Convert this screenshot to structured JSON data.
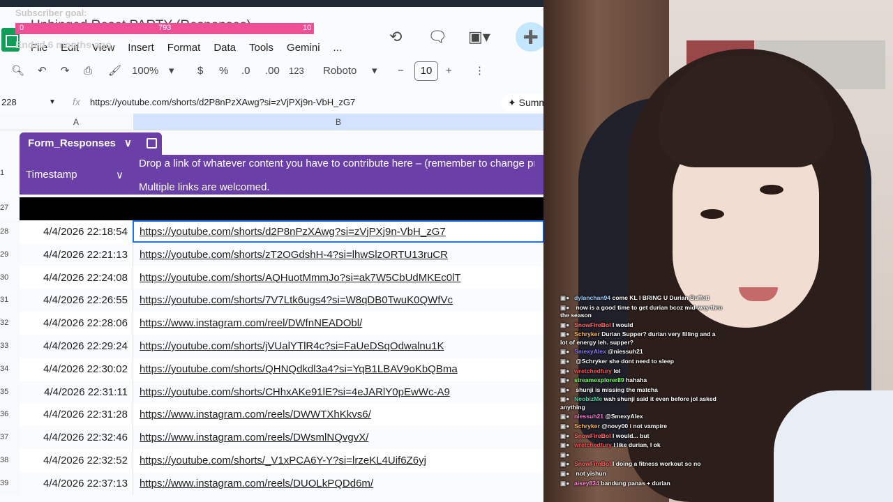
{
  "app": {
    "title": "Unhinged Reset PARTY (Responses)"
  },
  "overlay": {
    "goal_label": "Subscriber goal:",
    "goal_min": "0",
    "goal_current": "793",
    "goal_max": "10",
    "goal_status": "Ended 6 months ago"
  },
  "menu": [
    "File",
    "Edit",
    "View",
    "Insert",
    "Format",
    "Data",
    "Tools",
    "Gemini",
    "..."
  ],
  "toolbar": {
    "zoom": "100%",
    "currency": "$",
    "percent": "%",
    "dec_decrease": ".0",
    "dec_increase": ".00",
    "number_format": "123",
    "font": "Roboto",
    "font_size": "10",
    "minus": "−",
    "plus": "+"
  },
  "formula_bar": {
    "name_box": "228",
    "fx": "fx",
    "content": "https://youtube.com/shorts/d2P8nPzXAwg?si=zVjPXj9n-VbH_zG7",
    "summarize_label": "Summ"
  },
  "columns": [
    "A",
    "B"
  ],
  "table": {
    "name": "Form_Responses",
    "header_timestamp": "Timestamp",
    "header_b_line1": "Drop a link of whatever content you have to contribute here – (remember to change privac",
    "header_b_line2": "Multiple links are welcomed.",
    "header_row_num": "1",
    "black_row_num": "27"
  },
  "rows": [
    {
      "num": "28",
      "timestamp": "4/4/2026 22:18:54",
      "link": "https://youtube.com/shorts/d2P8nPzXAwg?si=zVjPXj9n-VbH_zG7"
    },
    {
      "num": "29",
      "timestamp": "4/4/2026 22:21:13",
      "link": "https://youtube.com/shorts/zT2OGdshH-4?si=lhwSlzORTU13ruCR"
    },
    {
      "num": "30",
      "timestamp": "4/4/2026 22:24:08",
      "link": "https://youtube.com/shorts/AQHuotMmmJo?si=ak7W5CbUdMKEc0lT"
    },
    {
      "num": "31",
      "timestamp": "4/4/2026 22:26:55",
      "link": "https://youtube.com/shorts/7V7Ltk6ugs4?si=W8qDB0TwuK0QWfVc"
    },
    {
      "num": "32",
      "timestamp": "4/4/2026 22:28:06",
      "link": "https://www.instagram.com/reel/DWfnNEADObl/"
    },
    {
      "num": "33",
      "timestamp": "4/4/2026 22:29:24",
      "link": "https://youtube.com/shorts/jVUalYTlR4c?si=FaUeDSqOdwalnu1K"
    },
    {
      "num": "34",
      "timestamp": "4/4/2026 22:30:02",
      "link": "https://youtube.com/shorts/QHNQdkdl3a4?si=YqB1LBAV9oKbQBma"
    },
    {
      "num": "35",
      "timestamp": "4/4/2026 22:31:11",
      "link": "https://youtube.com/shorts/CHhxAKe91lE?si=4eJARlY0pEwWc-A9"
    },
    {
      "num": "36",
      "timestamp": "4/4/2026 22:31:28",
      "link": "https://www.instagram.com/reels/DWWTXhKkvs6/"
    },
    {
      "num": "37",
      "timestamp": "4/4/2026 22:32:46",
      "link": "https://www.instagram.com/reels/DWsmlNQvgvX/"
    },
    {
      "num": "38",
      "timestamp": "4/4/2026 22:32:52",
      "link": "https://youtube.com/shorts/_V1xPCA6Y-Y?si=lrzeKL4Uif6Z6yj"
    },
    {
      "num": "39",
      "timestamp": "4/4/2026 22:37:13",
      "link": "https://www.instagram.com/reels/DUOLkPQDd6m/"
    }
  ],
  "chat": [
    {
      "user": "dylanchan94",
      "color": "#9fd2ff",
      "text": "come KL I BRING U Durian Buffett"
    },
    {
      "user": "",
      "color": "#7d7dff",
      "text": "now is a good time to get durian bcoz mid-way thru the season"
    },
    {
      "user": "SnowFireBol",
      "color": "#ff6a6a",
      "text": "I would"
    },
    {
      "user": "Schryker",
      "color": "#ffb84d",
      "text": "Durian Supper? durian very filling and a lot of energy leh. supper?"
    },
    {
      "user": "SmexyAlex",
      "color": "#8a7dff",
      "text": "@niessuh21"
    },
    {
      "user": "",
      "color": "#ff5da2",
      "text": "@Schryker she dont need to sleep"
    },
    {
      "user": "wretchedfury",
      "color": "#ff4f4f",
      "text": "lol"
    },
    {
      "user": "streamexplorer89",
      "color": "#7dff6a",
      "text": "hahaha"
    },
    {
      "user": "",
      "color": "#7d7dff",
      "text": "shunji is missing the matcha"
    },
    {
      "user": "NeobizMe",
      "color": "#4dd2a0",
      "text": "wah shunji said it even before jol asked anything"
    },
    {
      "user": "niessuh21",
      "color": "#ff7dd2",
      "text": "@SmexyAlex"
    },
    {
      "user": "Schryker",
      "color": "#ffb84d",
      "text": "@novy00 i not vampire"
    },
    {
      "user": "SnowFireBol",
      "color": "#ff6a6a",
      "text": "I would... but"
    },
    {
      "user": "wretchedfury",
      "color": "#ff4f4f",
      "text": "I like durian, I ok"
    },
    {
      "user": "",
      "color": "#ff5da2",
      "text": ""
    },
    {
      "user": "SnowFireBol",
      "color": "#ff6a6a",
      "text": "I doing a fitness workout so no"
    },
    {
      "user": "",
      "color": "#ff5da2",
      "text": "not yishun"
    },
    {
      "user": "aisey834",
      "color": "#ff8ad8",
      "text": "bandung panas + durian"
    }
  ]
}
